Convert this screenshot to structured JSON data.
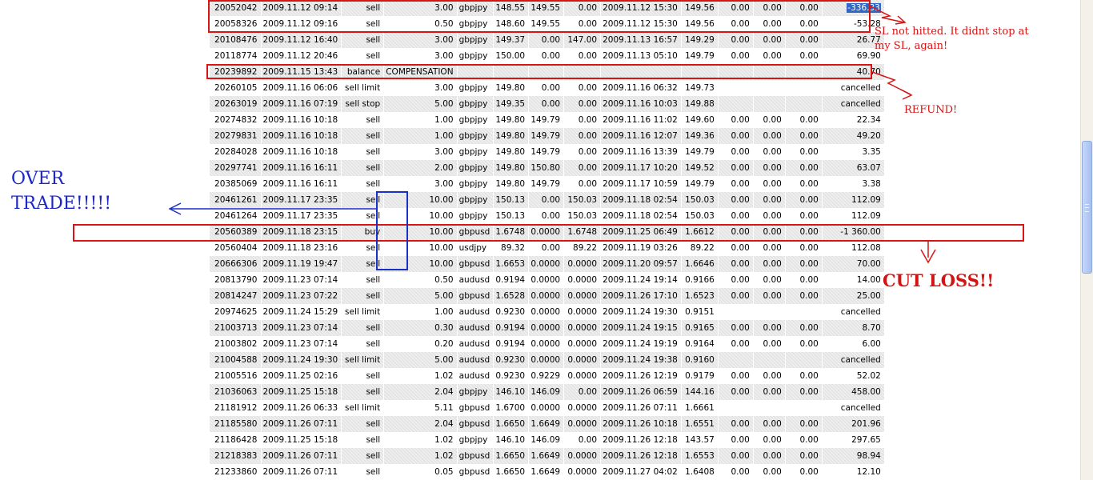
{
  "statement": {
    "rows": [
      [
        "20052042",
        "2009.11.12 09:14",
        "sell",
        "3.00",
        "gbpjpy",
        "148.55",
        "149.55",
        "0.00",
        "2009.11.12 15:30",
        "149.56",
        "0.00",
        "0.00",
        "0.00",
        "-336.33"
      ],
      [
        "20058326",
        "2009.11.12 09:16",
        "sell",
        "0.50",
        "gbpjpy",
        "148.60",
        "149.55",
        "0.00",
        "2009.11.12 15:30",
        "149.56",
        "0.00",
        "0.00",
        "0.00",
        "-53.28"
      ],
      [
        "20108476",
        "2009.11.12 16:40",
        "sell",
        "3.00",
        "gbpjpy",
        "149.37",
        "0.00",
        "147.00",
        "2009.11.13 16:57",
        "149.29",
        "0.00",
        "0.00",
        "0.00",
        "26.77"
      ],
      [
        "20118774",
        "2009.11.12 20:46",
        "sell",
        "3.00",
        "gbpjpy",
        "150.00",
        "0.00",
        "0.00",
        "2009.11.13 05:10",
        "149.79",
        "0.00",
        "0.00",
        "0.00",
        "69.90"
      ],
      [
        "20239892",
        "2009.11.15 13:43",
        "balance",
        "COMPENSATION",
        "",
        "",
        "",
        "",
        "",
        "",
        "",
        "",
        "",
        "40.70"
      ],
      [
        "20260105",
        "2009.11.16 06:06",
        "sell limit",
        "3.00",
        "gbpjpy",
        "149.80",
        "0.00",
        "0.00",
        "2009.11.16 06:32",
        "149.73",
        "",
        "",
        "",
        "cancelled"
      ],
      [
        "20263019",
        "2009.11.16 07:19",
        "sell stop",
        "5.00",
        "gbpjpy",
        "149.35",
        "0.00",
        "0.00",
        "2009.11.16 10:03",
        "149.88",
        "",
        "",
        "",
        "cancelled"
      ],
      [
        "20274832",
        "2009.11.16 10:18",
        "sell",
        "1.00",
        "gbpjpy",
        "149.80",
        "149.79",
        "0.00",
        "2009.11.16 11:02",
        "149.60",
        "0.00",
        "0.00",
        "0.00",
        "22.34"
      ],
      [
        "20279831",
        "2009.11.16 10:18",
        "sell",
        "1.00",
        "gbpjpy",
        "149.80",
        "149.79",
        "0.00",
        "2009.11.16 12:07",
        "149.36",
        "0.00",
        "0.00",
        "0.00",
        "49.20"
      ],
      [
        "20284028",
        "2009.11.16 10:18",
        "sell",
        "3.00",
        "gbpjpy",
        "149.80",
        "149.79",
        "0.00",
        "2009.11.16 13:39",
        "149.79",
        "0.00",
        "0.00",
        "0.00",
        "3.35"
      ],
      [
        "20297741",
        "2009.11.16 16:11",
        "sell",
        "2.00",
        "gbpjpy",
        "149.80",
        "150.80",
        "0.00",
        "2009.11.17 10:20",
        "149.52",
        "0.00",
        "0.00",
        "0.00",
        "63.07"
      ],
      [
        "20385069",
        "2009.11.16 16:11",
        "sell",
        "3.00",
        "gbpjpy",
        "149.80",
        "149.79",
        "0.00",
        "2009.11.17 10:59",
        "149.79",
        "0.00",
        "0.00",
        "0.00",
        "3.38"
      ],
      [
        "20461261",
        "2009.11.17 23:35",
        "sell",
        "10.00",
        "gbpjpy",
        "150.13",
        "0.00",
        "150.03",
        "2009.11.18 02:54",
        "150.03",
        "0.00",
        "0.00",
        "0.00",
        "112.09"
      ],
      [
        "20461264",
        "2009.11.17 23:35",
        "sell",
        "10.00",
        "gbpjpy",
        "150.13",
        "0.00",
        "150.03",
        "2009.11.18 02:54",
        "150.03",
        "0.00",
        "0.00",
        "0.00",
        "112.09"
      ],
      [
        "20560389",
        "2009.11.18 23:15",
        "buy",
        "10.00",
        "gbpusd",
        "1.6748",
        "0.0000",
        "1.6748",
        "2009.11.25 06:49",
        "1.6612",
        "0.00",
        "0.00",
        "0.00",
        "-1 360.00"
      ],
      [
        "20560404",
        "2009.11.18 23:16",
        "sell",
        "10.00",
        "usdjpy",
        "89.32",
        "0.00",
        "89.22",
        "2009.11.19 03:26",
        "89.22",
        "0.00",
        "0.00",
        "0.00",
        "112.08"
      ],
      [
        "20666306",
        "2009.11.19 19:47",
        "sell",
        "10.00",
        "gbpusd",
        "1.6653",
        "0.0000",
        "0.0000",
        "2009.11.20 09:57",
        "1.6646",
        "0.00",
        "0.00",
        "0.00",
        "70.00"
      ],
      [
        "20813790",
        "2009.11.23 07:14",
        "sell",
        "0.50",
        "audusd",
        "0.9194",
        "0.0000",
        "0.0000",
        "2009.11.24 19:14",
        "0.9166",
        "0.00",
        "0.00",
        "0.00",
        "14.00"
      ],
      [
        "20814247",
        "2009.11.23 07:22",
        "sell",
        "5.00",
        "gbpusd",
        "1.6528",
        "0.0000",
        "0.0000",
        "2009.11.26 17:10",
        "1.6523",
        "0.00",
        "0.00",
        "0.00",
        "25.00"
      ],
      [
        "20974625",
        "2009.11.24 15:29",
        "sell limit",
        "1.00",
        "audusd",
        "0.9230",
        "0.0000",
        "0.0000",
        "2009.11.24 19:30",
        "0.9151",
        "",
        "",
        "",
        "cancelled"
      ],
      [
        "21003713",
        "2009.11.23 07:14",
        "sell",
        "0.30",
        "audusd",
        "0.9194",
        "0.0000",
        "0.0000",
        "2009.11.24 19:15",
        "0.9165",
        "0.00",
        "0.00",
        "0.00",
        "8.70"
      ],
      [
        "21003802",
        "2009.11.23 07:14",
        "sell",
        "0.20",
        "audusd",
        "0.9194",
        "0.0000",
        "0.0000",
        "2009.11.24 19:19",
        "0.9164",
        "0.00",
        "0.00",
        "0.00",
        "6.00"
      ],
      [
        "21004588",
        "2009.11.24 19:30",
        "sell limit",
        "5.00",
        "audusd",
        "0.9230",
        "0.0000",
        "0.0000",
        "2009.11.24 19:38",
        "0.9160",
        "",
        "",
        "",
        "cancelled"
      ],
      [
        "21005516",
        "2009.11.25 02:16",
        "sell",
        "1.02",
        "audusd",
        "0.9230",
        "0.9229",
        "0.0000",
        "2009.11.26 12:19",
        "0.9179",
        "0.00",
        "0.00",
        "0.00",
        "52.02"
      ],
      [
        "21036063",
        "2009.11.25 15:18",
        "sell",
        "2.04",
        "gbpjpy",
        "146.10",
        "146.09",
        "0.00",
        "2009.11.26 06:59",
        "144.16",
        "0.00",
        "0.00",
        "0.00",
        "458.00"
      ],
      [
        "21181912",
        "2009.11.26 06:33",
        "sell limit",
        "5.11",
        "gbpusd",
        "1.6700",
        "0.0000",
        "0.0000",
        "2009.11.26 07:11",
        "1.6661",
        "",
        "",
        "",
        "cancelled"
      ],
      [
        "21185580",
        "2009.11.26 07:11",
        "sell",
        "2.04",
        "gbpusd",
        "1.6650",
        "1.6649",
        "0.0000",
        "2009.11.26 10:18",
        "1.6551",
        "0.00",
        "0.00",
        "0.00",
        "201.96"
      ],
      [
        "21186428",
        "2009.11.25 15:18",
        "sell",
        "1.02",
        "gbpjpy",
        "146.10",
        "146.09",
        "0.00",
        "2009.11.26 12:18",
        "143.57",
        "0.00",
        "0.00",
        "0.00",
        "297.65"
      ],
      [
        "21218383",
        "2009.11.26 07:11",
        "sell",
        "1.02",
        "gbpusd",
        "1.6650",
        "1.6649",
        "0.0000",
        "2009.11.26 12:18",
        "1.6553",
        "0.00",
        "0.00",
        "0.00",
        "98.94"
      ],
      [
        "21233860",
        "2009.11.26 07:11",
        "sell",
        "0.05",
        "gbpusd",
        "1.6650",
        "1.6649",
        "0.0000",
        "2009.11.27 04:02",
        "1.6408",
        "0.00",
        "0.00",
        "0.00",
        "12.10"
      ]
    ]
  },
  "annotations": {
    "over_trade": "OVER TRADE!!!!!",
    "sl_note": "SL not hitted. It didnt stop at my SL, again!",
    "refund": "REFUND!",
    "cut_loss": "CUT LOSS!!",
    "red_color": "#d81414",
    "blue_color": "#1a2fc4"
  },
  "selection": {
    "highlight_color": "#3168c5"
  }
}
